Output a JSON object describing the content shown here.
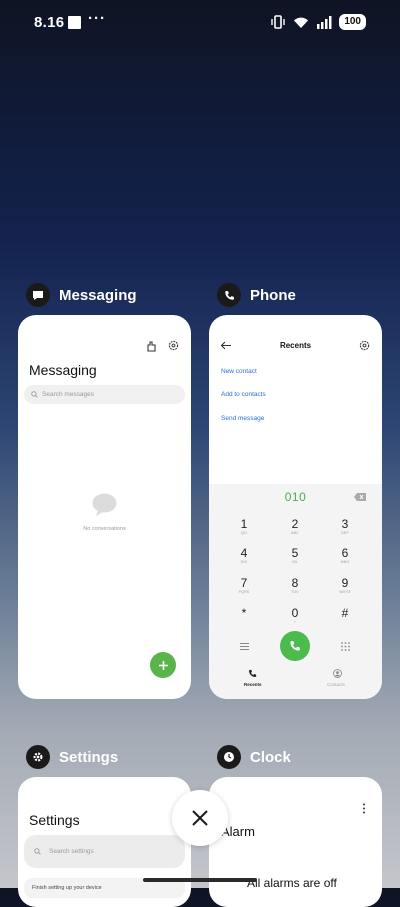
{
  "status_bar": {
    "time": "8.16",
    "dots": "···",
    "battery": "100"
  },
  "apps": {
    "messaging": {
      "label": "Messaging",
      "title": "Messaging",
      "search_placeholder": "Search messages",
      "empty_text": "No conversations"
    },
    "phone": {
      "label": "Phone",
      "title": "Recents",
      "links": [
        "New contact",
        "Add to contacts",
        "Send message"
      ],
      "dialed_number": "010",
      "keys": [
        {
          "digit": "1",
          "letters": "QO"
        },
        {
          "digit": "2",
          "letters": "ABC"
        },
        {
          "digit": "3",
          "letters": "DEF"
        },
        {
          "digit": "4",
          "letters": "GHI"
        },
        {
          "digit": "5",
          "letters": "JKL"
        },
        {
          "digit": "6",
          "letters": "MNO"
        },
        {
          "digit": "7",
          "letters": "PQRS"
        },
        {
          "digit": "8",
          "letters": "TUV"
        },
        {
          "digit": "9",
          "letters": "WXYZ"
        },
        {
          "digit": "*",
          "letters": ""
        },
        {
          "digit": "0",
          "letters": "+"
        },
        {
          "digit": "#",
          "letters": ""
        }
      ],
      "tab_recents": "Recents",
      "tab_contacts": "Contacts"
    },
    "settings": {
      "label": "Settings",
      "title": "Settings",
      "search_placeholder": "Search settings",
      "row_text": "Finish setting up your device"
    },
    "clock": {
      "label": "Clock",
      "title": "Alarm",
      "empty_text": "All alarms are off"
    }
  },
  "colors": {
    "accent_green": "#4cbb4e",
    "link_blue": "#2a6fd6"
  }
}
